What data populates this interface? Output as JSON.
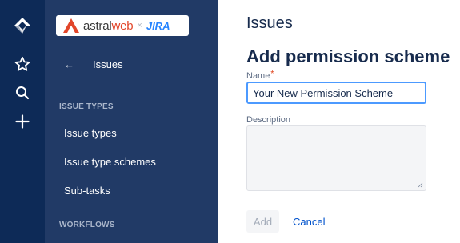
{
  "sidebar": {
    "logo": {
      "brand_part1": "astral",
      "brand_part2": "web",
      "times": "×",
      "product": "JIRA"
    },
    "back_label": "Issues",
    "sections": [
      {
        "title": "ISSUE TYPES",
        "items": [
          "Issue types",
          "Issue type schemes",
          "Sub-tasks"
        ]
      },
      {
        "title": "WORKFLOWS",
        "items": []
      }
    ]
  },
  "rail": {
    "icons": [
      "jira-logo-icon",
      "star-icon",
      "search-icon",
      "plus-icon"
    ]
  },
  "main": {
    "breadcrumb": "Issues",
    "title": "Add permission scheme",
    "name_label": "Name",
    "required_mark": "*",
    "name_value": "Your New Permission Scheme",
    "description_label": "Description",
    "description_value": "",
    "add_label": "Add",
    "cancel_label": "Cancel"
  },
  "colors": {
    "rail_bg": "#0d2a57",
    "sidebar_bg": "#213a66",
    "focus": "#4c9aff",
    "link": "#0052cc",
    "brand_accent": "#e2462a"
  }
}
